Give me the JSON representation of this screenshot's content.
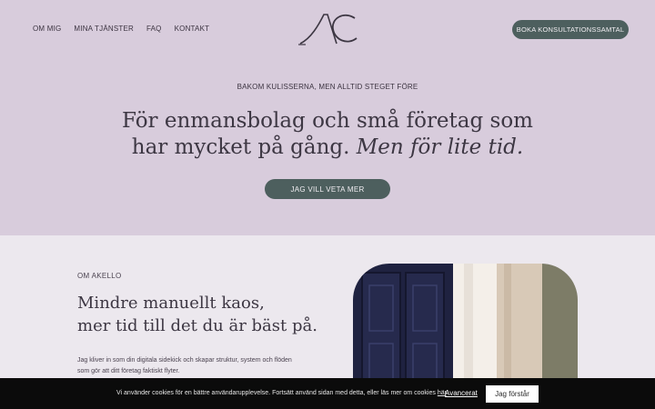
{
  "nav": {
    "items": [
      "OM MIG",
      "MINA TJÄNSTER",
      "FAQ",
      "KONTAKT"
    ],
    "cta": "BOKA KONSULTATIONSSAMTAL"
  },
  "logo": {
    "text": "AC"
  },
  "hero": {
    "eyebrow": "BAKOM KULISSERNA, MEN ALLTID STEGET FÖRE",
    "line1": "För enmansbolag och små företag som",
    "line2_plain": "har mycket på gång.",
    "line2_italic": "Men för lite tid.",
    "button": "JAG VILL VETA MER"
  },
  "about": {
    "eyebrow": "OM AKELLO",
    "title_line1": "Mindre manuellt kaos,",
    "title_line2": "mer tid till det du är bäst på.",
    "text_line1": "Jag kliver in som din digitala sidekick och skapar struktur, system och flöden",
    "text_line2": "som gör att ditt företag faktiskt flyter."
  },
  "cookie": {
    "text": "Vi använder cookies för en bättre användarupplevelse. Fortsätt använd sidan med detta, eller läs mer om cookies",
    "link": "här",
    "period": ".",
    "advanced": "Avancerat",
    "accept": "Jag förstår"
  },
  "colors": {
    "hero_bg": "#d8ccdc",
    "page_bg": "#ece8ee",
    "button": "#4d5f5e",
    "text": "#3b3340",
    "cookie_bg": "#0b0b0b"
  }
}
